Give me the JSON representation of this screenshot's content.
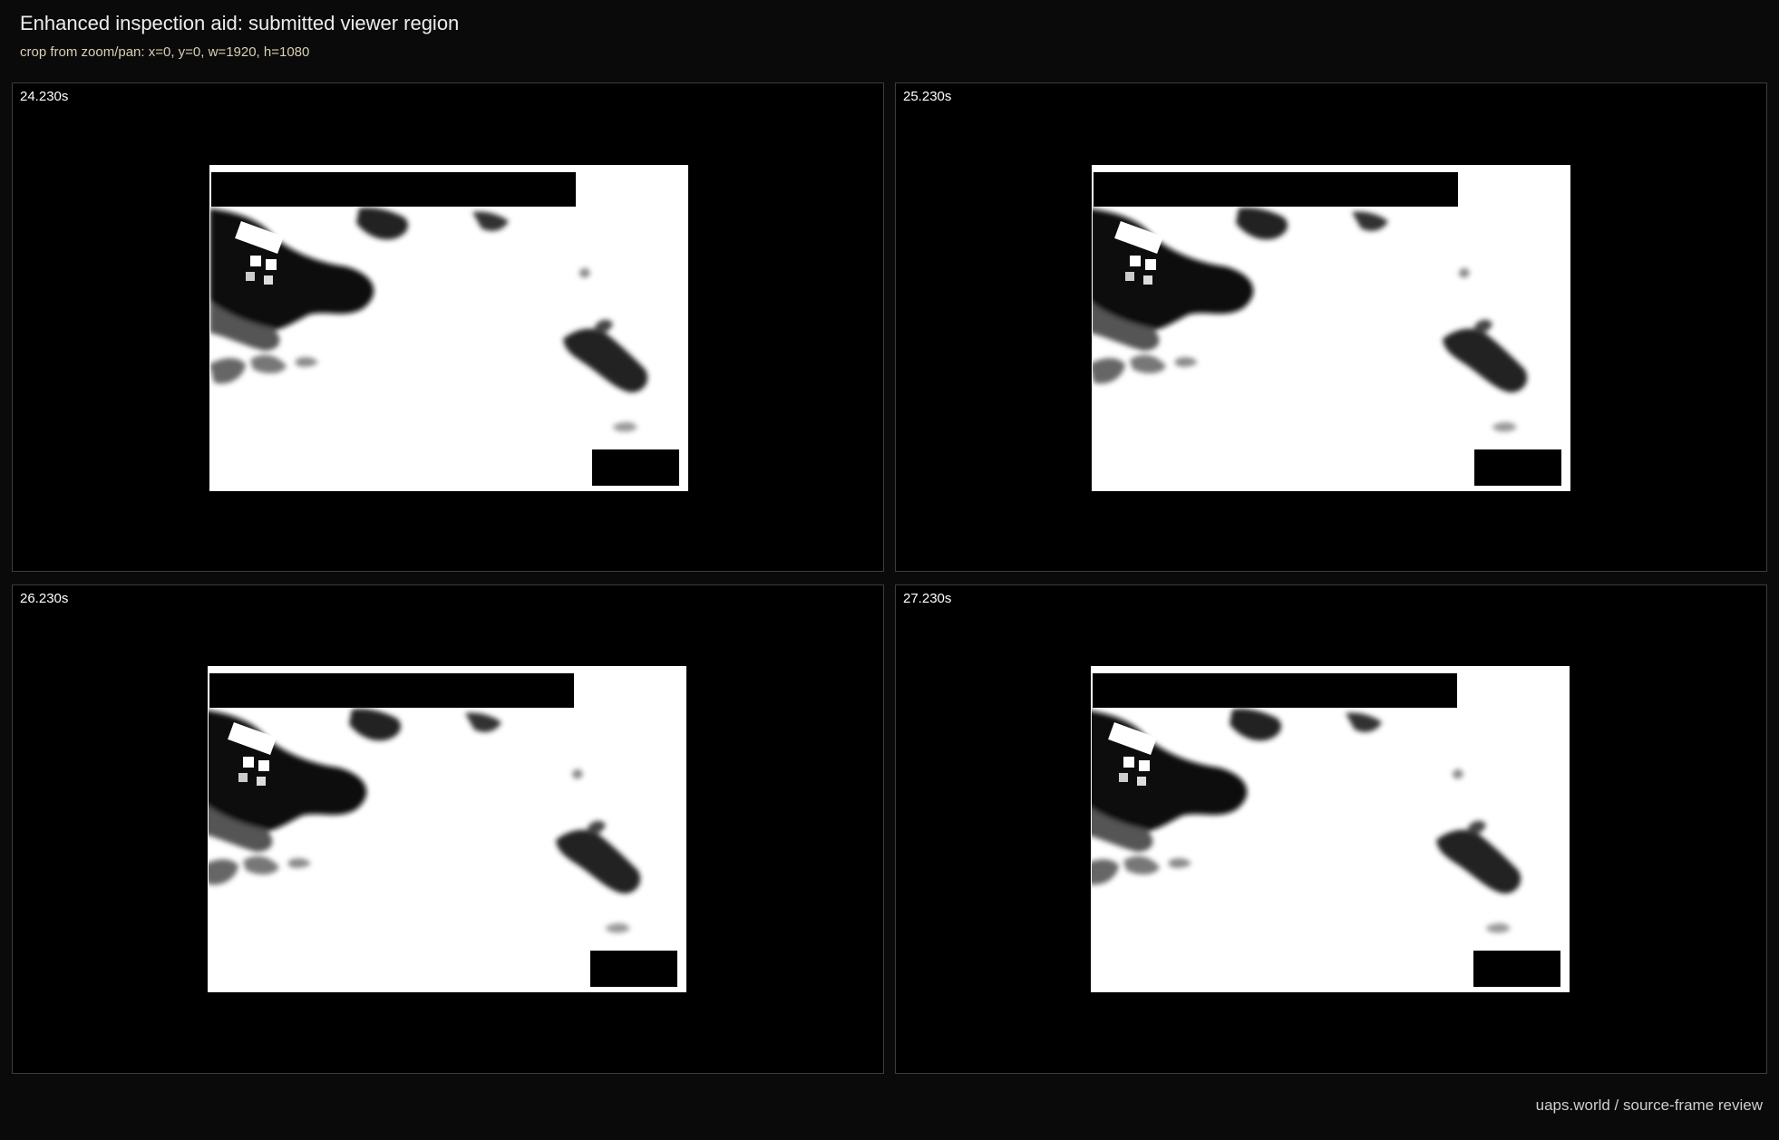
{
  "header": {
    "title": "Enhanced inspection aid: submitted viewer region",
    "subtitle": "crop from zoom/pan: x=0, y=0, w=1920, h=1080"
  },
  "panels": [
    {
      "timestamp": "24.230s"
    },
    {
      "timestamp": "25.230s"
    },
    {
      "timestamp": "26.230s"
    },
    {
      "timestamp": "27.230s"
    }
  ],
  "footer": {
    "credit": "uaps.world / source-frame review"
  }
}
